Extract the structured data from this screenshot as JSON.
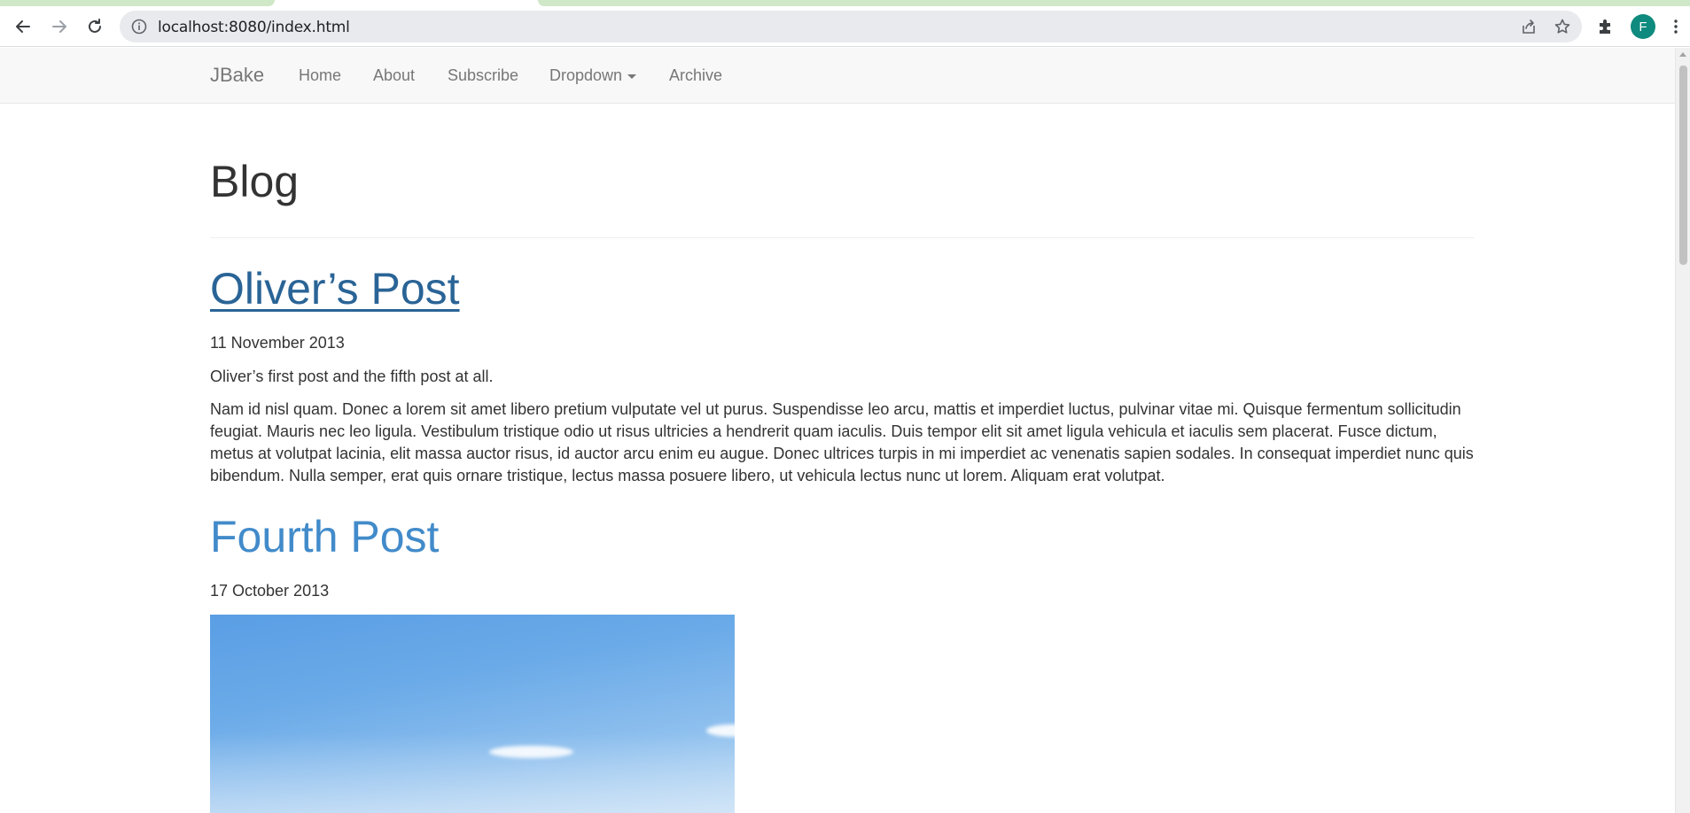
{
  "browser": {
    "url": "localhost:8080/index.html",
    "profile_initial": "F",
    "accent_color": "#0e8a7e",
    "icons": [
      "back-arrow-icon",
      "forward-arrow-icon",
      "reload-icon",
      "site-info-icon",
      "share-icon",
      "bookmark-star-icon",
      "extensions-puzzle-icon",
      "kebab-menu-icon"
    ]
  },
  "navbar": {
    "brand": "JBake",
    "items": [
      {
        "label": "Home"
      },
      {
        "label": "About"
      },
      {
        "label": "Subscribe"
      },
      {
        "label": "Dropdown",
        "has_caret": true
      },
      {
        "label": "Archive"
      }
    ]
  },
  "page": {
    "title": "Blog"
  },
  "posts": [
    {
      "title": "Oliver’s Post",
      "date": "11 November 2013",
      "summary": "Oliver’s first post and the fifth post at all.",
      "body": "Nam id nisl quam. Donec a lorem sit amet libero pretium vulputate vel ut purus. Suspendisse leo arcu, mattis et imperdiet luctus, pulvinar vitae mi. Quisque fermentum sollicitudin feugiat. Mauris nec leo ligula. Vestibulum tristique odio ut risus ultricies a hendrerit quam iaculis. Duis tempor elit sit amet ligula vehicula et iaculis sem placerat. Fusce dictum, metus at volutpat lacinia, elit massa auctor risus, id auctor arcu enim eu augue. Donec ultrices turpis in mi imperdiet ac venenatis sapien sodales. In consequat imperdiet nunc quis bibendum. Nulla semper, erat quis ornare tristique, lectus massa posuere libero, ut vehicula lectus nunc ut lorem. Aliquam erat volutpat.",
      "link_state": "hover"
    },
    {
      "title": "Fourth Post",
      "date": "17 October 2013",
      "image": "sky-photo"
    }
  ],
  "colors": {
    "link": "#428bca",
    "link_hover": "#2a6496",
    "navbar_bg": "#f8f8f8",
    "nav_text": "#777777"
  }
}
